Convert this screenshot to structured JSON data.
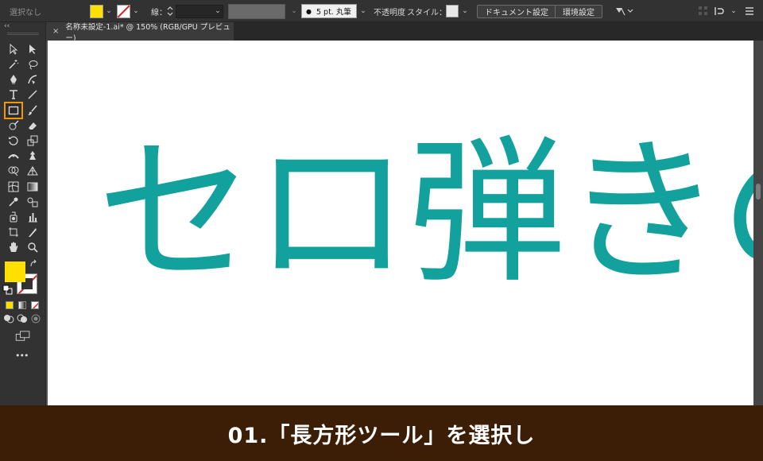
{
  "control_bar": {
    "selection_label": "選択なし",
    "fill_color": "#ffe000",
    "stroke_label": "線：",
    "stroke_weight_value": "",
    "brush_value": "5 pt. 丸筆",
    "opacity_label": "不透明度",
    "style_label": "スタイル：",
    "document_settings_label": "ドキュメント設定",
    "preferences_label": "環境設定"
  },
  "document_tab": {
    "close": "×",
    "title": "名称未設定-1.ai* @ 150% (RGB/GPU プレビュー)"
  },
  "tools_panel": {
    "collapse": "‹‹",
    "more": "•••",
    "selected_tool": "rectangle-tool",
    "fill_color": "#ffe000",
    "highlight_color": "#f39800"
  },
  "canvas": {
    "text": "セロ弾きの",
    "text_color": "#12a19c",
    "zoom": "150%"
  },
  "caption": {
    "text": "01.「長方形ツール」を選択し",
    "background": "#3c1e07"
  }
}
